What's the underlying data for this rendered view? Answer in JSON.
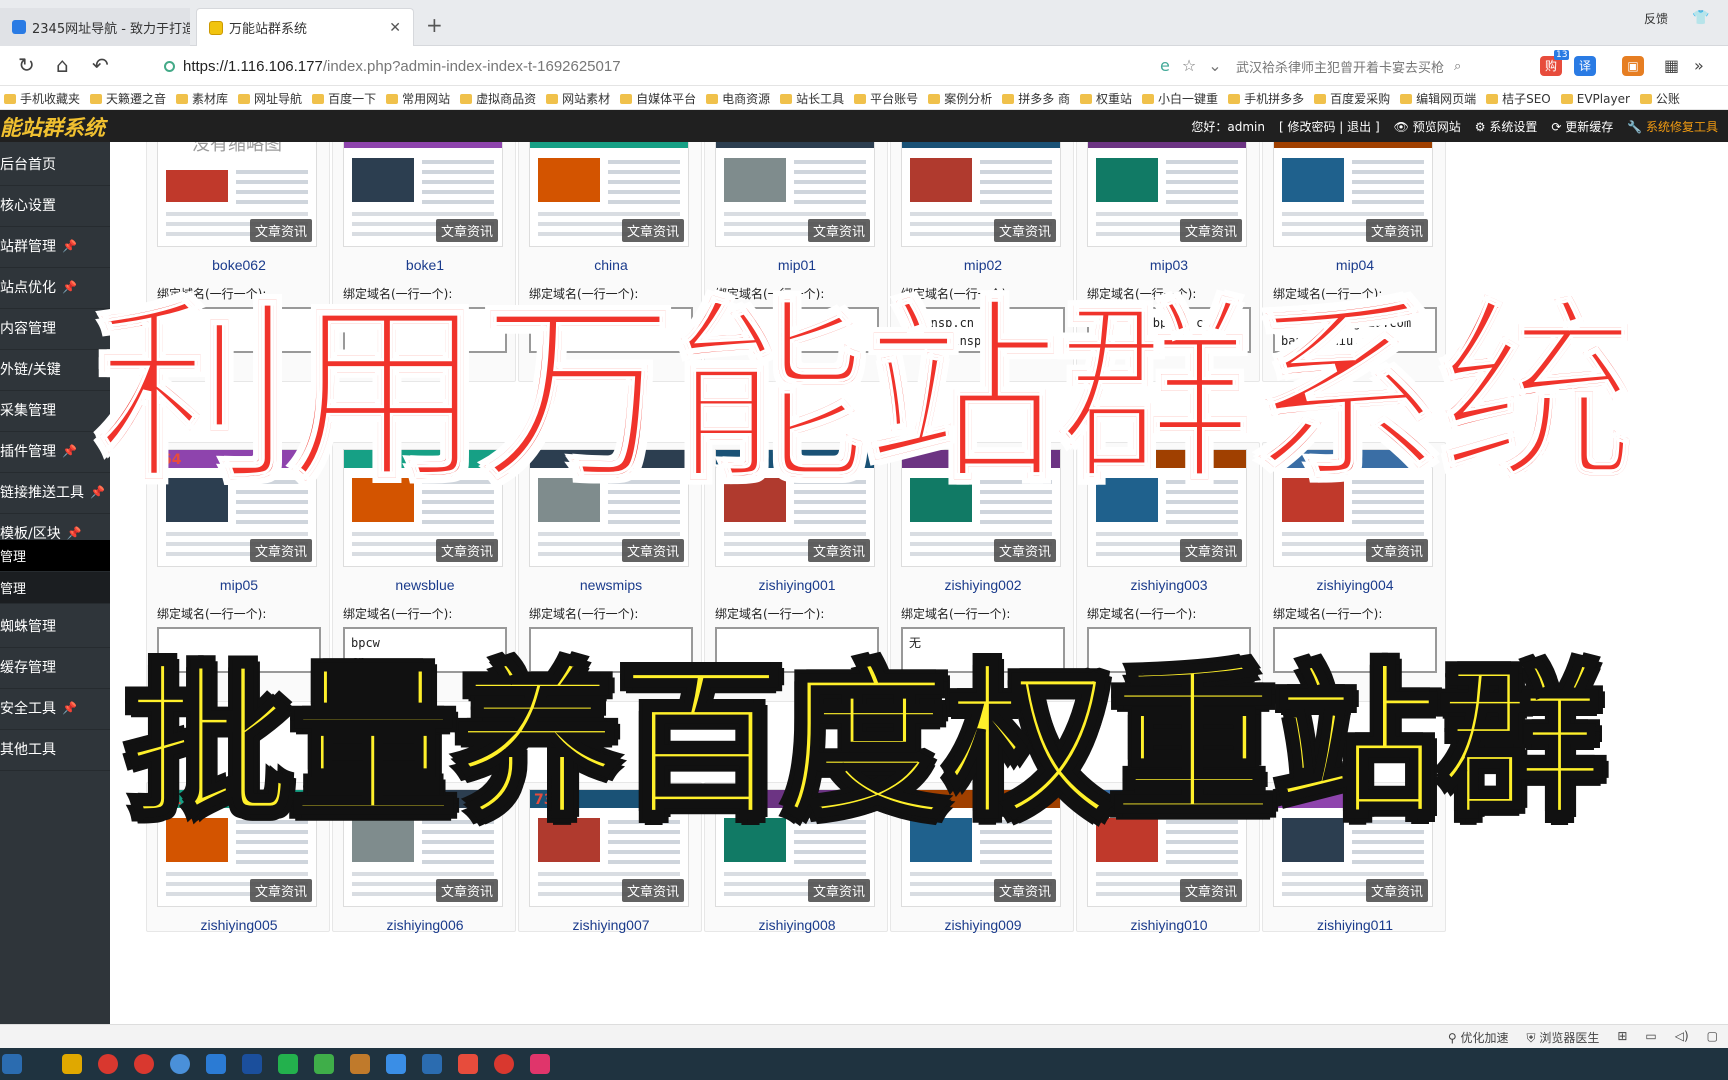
{
  "browser": {
    "tabs": [
      {
        "label": "2345网址导航 - 致力于打造百",
        "active": false
      },
      {
        "label": "万能站群系统",
        "active": true
      }
    ],
    "tab_right": {
      "feedback": "反馈",
      "shirt": "👕"
    },
    "address": {
      "host": "https://1.116.106.177",
      "path": "/index.php?admin-index-index-t-1692625017"
    },
    "search_text": "武汉袷杀律师主犯曾开着卡宴去买枪",
    "ext_badge": "13",
    "bookmarks": [
      "手机收藏夹",
      "天籁遷之音",
      "素材库",
      "网址导航",
      "百度一下",
      "常用网站",
      "虚拟商品资",
      "网站素材",
      "自媒体平台",
      "电商资源",
      "站长工具",
      "平台账号",
      "案例分析",
      "拼多多 商",
      "权重站",
      "小白一键重",
      "手机拼多多",
      "百度爱采购",
      "编辑网页端",
      "桔子SEO",
      "EVPlayer",
      "公账"
    ]
  },
  "app": {
    "brand": "能站群系统",
    "header": {
      "greeting": "您好：admin",
      "account_links": "[ 修改密码 | 退出 ]",
      "preview": "预览网站",
      "settings": "系统设置",
      "cache": "更新缓存",
      "repair": "系统修复工具"
    },
    "sidebar": [
      {
        "label": "后台首页",
        "pin": false
      },
      {
        "label": "核心设置",
        "pin": false
      },
      {
        "label": "站群管理",
        "pin": true
      },
      {
        "label": "站点优化",
        "pin": true
      },
      {
        "label": "内容管理",
        "pin": false
      },
      {
        "label": "外链/关键",
        "pin": false
      },
      {
        "label": "采集管理",
        "pin": false
      },
      {
        "label": "插件管理",
        "pin": true
      },
      {
        "label": "链接推送工具",
        "pin": true
      },
      {
        "label": "模板/区块",
        "pin": true
      },
      {
        "label": "管理",
        "sub": true,
        "active": true
      },
      {
        "label": "管理",
        "sub": true,
        "active": false
      },
      {
        "label": "蜘蛛管理",
        "pin": false
      },
      {
        "label": "缓存管理",
        "pin": false
      },
      {
        "label": "安全工具",
        "pin": true
      },
      {
        "label": "其他工具",
        "pin": false
      }
    ],
    "card_category": "文章资讯",
    "domain_label": "绑定域名(一行一个):",
    "rows": [
      {
        "sites": [
          {
            "name": "boke062",
            "domains": "",
            "thumb_text": "没有缩略图"
          },
          {
            "name": "boke1",
            "domains": ""
          },
          {
            "name": "china",
            "domains": ""
          },
          {
            "name": "mip01",
            "domains": ""
          },
          {
            "name": "mip02",
            "domains": "cninsp.cn\nwww.cninsp.cn"
          },
          {
            "name": "mip03",
            "domains": "daikuan.bpcww.cn"
          },
          {
            "name": "mip04",
            "domains": "www.bangongniu.com\nbangongniu.co"
          }
        ]
      },
      {
        "sites": [
          {
            "name": "mip05",
            "num": "64",
            "domains": ""
          },
          {
            "name": "newsblue",
            "domains": "bpcw\ncn"
          },
          {
            "name": "newsmips",
            "domains": ""
          },
          {
            "name": "zishiying001",
            "domains": ""
          },
          {
            "name": "zishiying002",
            "domains": "无"
          },
          {
            "name": "zishiying003",
            "domains": ""
          },
          {
            "name": "zishiying004",
            "domains": ""
          }
        ]
      },
      {
        "sites": [
          {
            "name": "zishiying005",
            "num": "71"
          },
          {
            "name": "zishiying006",
            "num": "72"
          },
          {
            "name": "zishiying007",
            "num": "73"
          },
          {
            "name": "zishiying008",
            "num": "74"
          },
          {
            "name": "zishiying009",
            "num": "75"
          },
          {
            "name": "zishiying010",
            "num": "76"
          },
          {
            "name": "zishiying011",
            "num": "77"
          }
        ]
      }
    ]
  },
  "overlay": {
    "line1": "利用万能站群系统",
    "line2": "批量养百度权重站群"
  },
  "statusbar": [
    "优化加速",
    "浏览器医生"
  ],
  "colors": {
    "overlay_red": "#f0332b",
    "overlay_yellow": "#fff02a",
    "brand": "#f0c030",
    "sidebar": "#2f353a",
    "site_name": "#1a3b8c"
  }
}
